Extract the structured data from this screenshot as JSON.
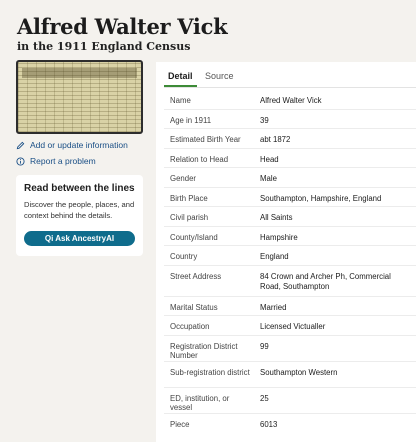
{
  "header": {
    "title": "Alfred Walter Vick",
    "subtitle": "in the 1911 England Census"
  },
  "sidebar": {
    "actions": [
      {
        "label": "Add or update information",
        "icon": "pencil-icon"
      },
      {
        "label": "Report a problem",
        "icon": "info-icon"
      }
    ],
    "promo": {
      "heading": "Read between the lines",
      "body": "Discover the people, places, and context behind the details.",
      "button_label": "Qi Ask AncestryAI"
    }
  },
  "tabs": [
    {
      "label": "Detail",
      "active": true
    },
    {
      "label": "Source",
      "active": false
    }
  ],
  "details": [
    {
      "label": "Name",
      "value": "Alfred Walter Vick"
    },
    {
      "label": "Age in 1911",
      "value": "39"
    },
    {
      "label": "Estimated Birth Year",
      "value": "abt 1872"
    },
    {
      "label": "Relation to Head",
      "value": "Head"
    },
    {
      "label": "Gender",
      "value": "Male"
    },
    {
      "label": "Birth Place",
      "value": "Southampton, Hampshire, England"
    },
    {
      "label": "Civil parish",
      "value": "All Saints"
    },
    {
      "label": "County/Island",
      "value": "Hampshire"
    },
    {
      "label": "Country",
      "value": "England"
    },
    {
      "label": "Street Address",
      "value": "84 Crown and Archer Ph, Commercial Road, Southampton"
    },
    {
      "label": "Marital Status",
      "value": "Married"
    },
    {
      "label": "Occupation",
      "value": "Licensed Victualler"
    },
    {
      "label": "Registration District Number",
      "value": "99"
    },
    {
      "label": "Sub-registration district",
      "value": "Southampton Western"
    },
    {
      "label": "ED, institution, or vessel",
      "value": "25"
    },
    {
      "label": "Piece",
      "value": "6013"
    }
  ],
  "colors": {
    "accent_green": "#3d8b37",
    "link_blue": "#1a4f86",
    "button_teal": "#0f6c8c",
    "page_bg": "#f4f2ee"
  }
}
